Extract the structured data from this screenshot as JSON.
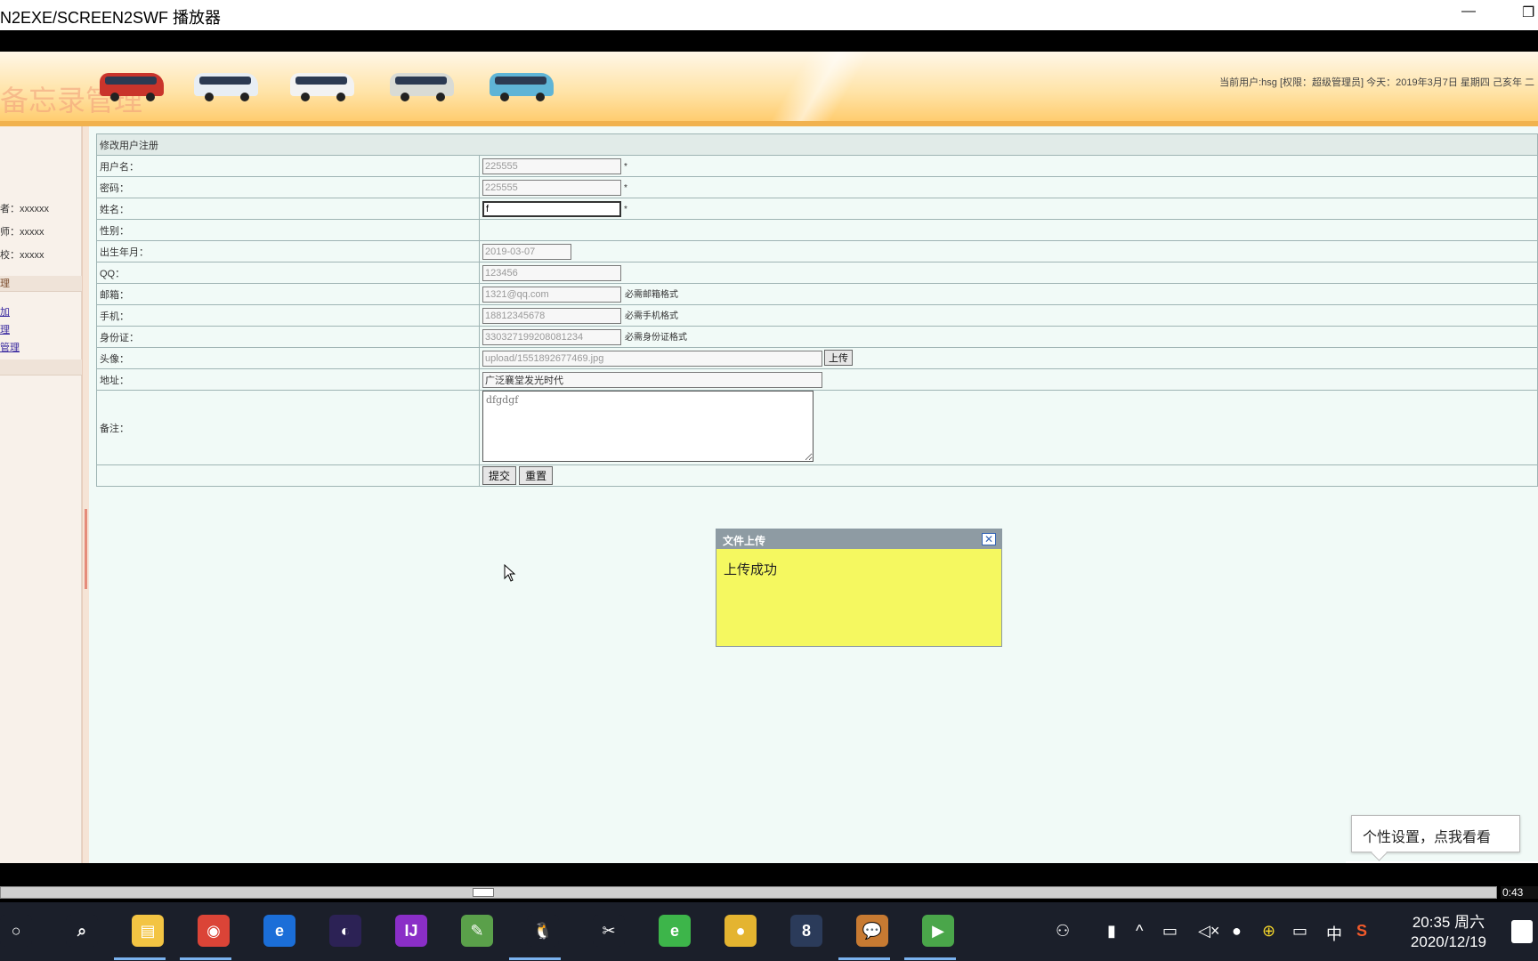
{
  "window": {
    "title": "N2EXE/SCREEN2SWF 播放器",
    "minimize_glyph": "—",
    "restore_glyph": "❐"
  },
  "banner": {
    "watermark": "备忘录管理",
    "user_info": "当前用户:hsg [权限：超级管理员] 今天：2019年3月7日 星期四 己亥年 二"
  },
  "sidebar": {
    "info_rows": [
      "者：xxxxxx",
      "师：xxxxx",
      "校：xxxxx"
    ],
    "section": "理",
    "links": [
      "加",
      "理",
      "管理"
    ]
  },
  "form": {
    "title": "修改用户注册",
    "fields": {
      "username": {
        "label": "用户名：",
        "value": "225555",
        "mark": "*"
      },
      "password": {
        "label": "密码：",
        "value": "225555",
        "mark": "*"
      },
      "name": {
        "label": "姓名：",
        "value": "f",
        "mark": "*"
      },
      "gender": {
        "label": "性别："
      },
      "birthday": {
        "label": "出生年月：",
        "value": "2019-03-07"
      },
      "qq": {
        "label": "QQ：",
        "value": "123456"
      },
      "email": {
        "label": "邮箱：",
        "value": "1321@qq.com",
        "hint": "必需邮箱格式"
      },
      "phone": {
        "label": "手机：",
        "value": "18812345678",
        "hint": "必需手机格式"
      },
      "idcard": {
        "label": "身份证：",
        "value": "330327199208081234",
        "hint": "必需身份证格式"
      },
      "avatar": {
        "label": "头像：",
        "value": "upload/1551892677469.jpg",
        "button": "上传"
      },
      "address": {
        "label": "地址：",
        "value": "广泛襄堂发光时代"
      },
      "remark": {
        "label": "备注：",
        "value": "dfgdgf"
      }
    },
    "submit_label": "提交",
    "reset_label": "重置"
  },
  "dialog": {
    "title": "文件上传",
    "close_glyph": "✕",
    "message": "上传成功"
  },
  "ime": {
    "tip": "个性设置，点我看看",
    "logo": "S",
    "mode": "中",
    "punct": "°,",
    "emoji": "☺",
    "mic": "🎤",
    "keyboard": "⌨"
  },
  "player": {
    "progress": 0.32,
    "time": "0:43"
  },
  "taskbar": {
    "apps": [
      {
        "name": "cortana-icon",
        "glyph": "○",
        "color": "#1b1f2a"
      },
      {
        "name": "search-icon",
        "glyph": "⌕",
        "color": "#1b1f2a"
      },
      {
        "name": "file-explorer-icon",
        "glyph": "▤",
        "color": "#f3c443"
      },
      {
        "name": "chrome-icon",
        "glyph": "◉",
        "color": "#db4437"
      },
      {
        "name": "edge-icon",
        "glyph": "e",
        "color": "#1b6ed8"
      },
      {
        "name": "eclipse-icon",
        "glyph": "◐",
        "color": "#2c2255"
      },
      {
        "name": "intellij-icon",
        "glyph": "IJ",
        "color": "#8a2ec7"
      },
      {
        "name": "notepad-icon",
        "glyph": "✎",
        "color": "#5aa04a"
      },
      {
        "name": "qq-icon",
        "glyph": "🐧",
        "color": "#1b1f2a"
      },
      {
        "name": "tools-icon",
        "glyph": "✂",
        "color": "#1b1f2a"
      },
      {
        "name": "ie-green-icon",
        "glyph": "e",
        "color": "#3db54a"
      },
      {
        "name": "chicken-icon",
        "glyph": "●",
        "color": "#e4b430"
      },
      {
        "name": "s-app-icon",
        "glyph": "8",
        "color": "#2b3b5a"
      },
      {
        "name": "wechat-icon",
        "glyph": "💬",
        "color": "#c77a32"
      },
      {
        "name": "player-icon",
        "glyph": "▶",
        "color": "#4aa64a"
      }
    ],
    "tray": {
      "ime_lang": "中",
      "time": "20:35 周六",
      "date": "2020/12/19"
    }
  }
}
